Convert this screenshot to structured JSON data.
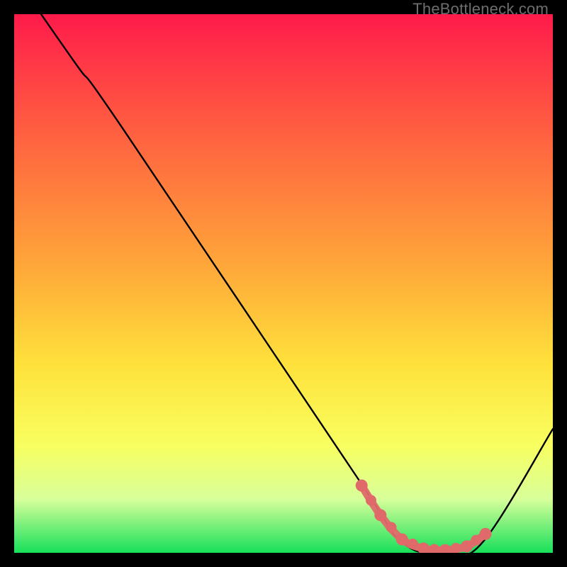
{
  "watermark": "TheBottleneck.com",
  "chart_data": {
    "type": "line",
    "title": "",
    "xlabel": "",
    "ylabel": "",
    "xlim": [
      0,
      100
    ],
    "ylim": [
      0,
      100
    ],
    "gradient_stops": [
      {
        "offset": 0,
        "color": "#ff1b4b"
      },
      {
        "offset": 20,
        "color": "#ff5a41"
      },
      {
        "offset": 45,
        "color": "#ffa23a"
      },
      {
        "offset": 65,
        "color": "#ffe13b"
      },
      {
        "offset": 80,
        "color": "#f8ff60"
      },
      {
        "offset": 90,
        "color": "#d8ff9a"
      },
      {
        "offset": 100,
        "color": "#17e05a"
      }
    ],
    "series": [
      {
        "name": "bottleneck-curve",
        "points": [
          {
            "x": 5,
            "y": 100
          },
          {
            "x": 12,
            "y": 90
          },
          {
            "x": 20,
            "y": 79
          },
          {
            "x": 63,
            "y": 15
          },
          {
            "x": 72,
            "y": 2
          },
          {
            "x": 80,
            "y": 0
          },
          {
            "x": 87,
            "y": 2
          },
          {
            "x": 100,
            "y": 23
          }
        ]
      }
    ],
    "highlight_segment": {
      "color": "#e06a6a",
      "points": [
        {
          "x": 64.5,
          "y": 12.5
        },
        {
          "x": 68,
          "y": 7
        },
        {
          "x": 72,
          "y": 2.5
        },
        {
          "x": 76,
          "y": 0.8
        },
        {
          "x": 80,
          "y": 0.5
        },
        {
          "x": 84,
          "y": 1.2
        },
        {
          "x": 87.5,
          "y": 3.5
        }
      ]
    }
  }
}
